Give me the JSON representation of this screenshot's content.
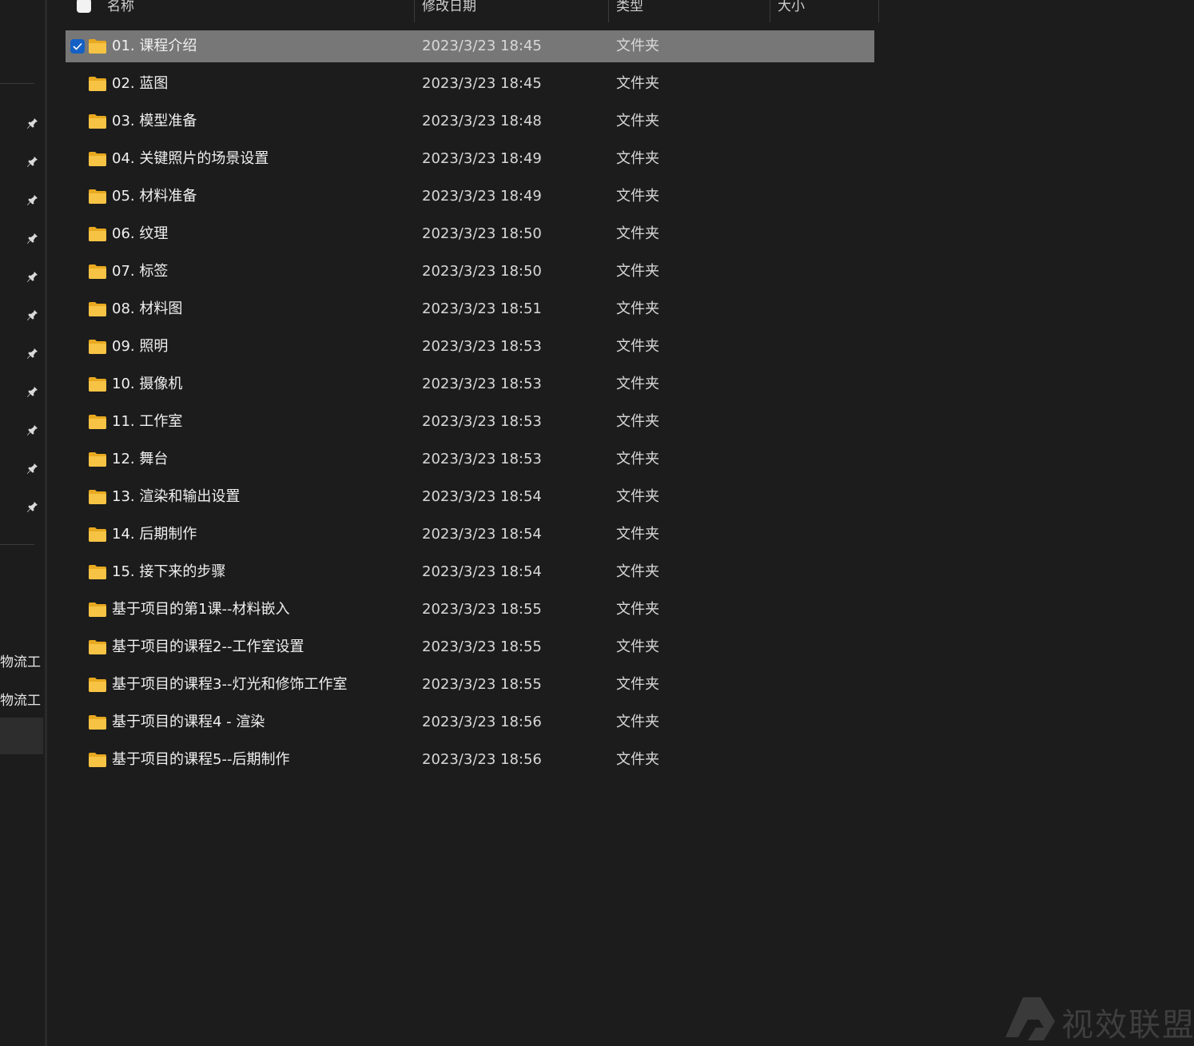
{
  "header": {
    "name": "名称",
    "date": "修改日期",
    "type": "类型",
    "size": "大小"
  },
  "sidebar": {
    "items": [
      {
        "label": "物流工"
      },
      {
        "label": "物流工"
      }
    ],
    "pin_icon": "pin-icon"
  },
  "files": [
    {
      "name": "01. 课程介绍",
      "date": "2023/3/23 18:45",
      "type": "文件夹",
      "size": "",
      "selected": true
    },
    {
      "name": "02. 蓝图",
      "date": "2023/3/23 18:45",
      "type": "文件夹",
      "size": ""
    },
    {
      "name": "03. 模型准备",
      "date": "2023/3/23 18:48",
      "type": "文件夹",
      "size": ""
    },
    {
      "name": "04. 关键照片的场景设置",
      "date": "2023/3/23 18:49",
      "type": "文件夹",
      "size": ""
    },
    {
      "name": "05. 材料准备",
      "date": "2023/3/23 18:49",
      "type": "文件夹",
      "size": ""
    },
    {
      "name": "06. 纹理",
      "date": "2023/3/23 18:50",
      "type": "文件夹",
      "size": ""
    },
    {
      "name": "07. 标签",
      "date": "2023/3/23 18:50",
      "type": "文件夹",
      "size": ""
    },
    {
      "name": "08. 材料图",
      "date": "2023/3/23 18:51",
      "type": "文件夹",
      "size": ""
    },
    {
      "name": "09. 照明",
      "date": "2023/3/23 18:53",
      "type": "文件夹",
      "size": ""
    },
    {
      "name": "10. 摄像机",
      "date": "2023/3/23 18:53",
      "type": "文件夹",
      "size": ""
    },
    {
      "name": "11. 工作室",
      "date": "2023/3/23 18:53",
      "type": "文件夹",
      "size": ""
    },
    {
      "name": "12. 舞台",
      "date": "2023/3/23 18:53",
      "type": "文件夹",
      "size": ""
    },
    {
      "name": "13. 渲染和输出设置",
      "date": "2023/3/23 18:54",
      "type": "文件夹",
      "size": ""
    },
    {
      "name": "14. 后期制作",
      "date": "2023/3/23 18:54",
      "type": "文件夹",
      "size": ""
    },
    {
      "name": "15. 接下来的步骤",
      "date": "2023/3/23 18:54",
      "type": "文件夹",
      "size": ""
    },
    {
      "name": "基于项目的第1课--材料嵌入",
      "date": "2023/3/23 18:55",
      "type": "文件夹",
      "size": ""
    },
    {
      "name": "基于项目的课程2--工作室设置",
      "date": "2023/3/23 18:55",
      "type": "文件夹",
      "size": ""
    },
    {
      "name": "基于项目的课程3--灯光和修饰工作室",
      "date": "2023/3/23 18:55",
      "type": "文件夹",
      "size": ""
    },
    {
      "name": "基于项目的课程4 - 渲染",
      "date": "2023/3/23 18:56",
      "type": "文件夹",
      "size": ""
    },
    {
      "name": "基于项目的课程5--后期制作",
      "date": "2023/3/23 18:56",
      "type": "文件夹",
      "size": ""
    }
  ],
  "watermark": {
    "text": "视效联盟"
  },
  "colors": {
    "folder": "#f6c344",
    "selection": "#777777",
    "checkbox": "#1460c4",
    "background": "#1c1c1c"
  }
}
